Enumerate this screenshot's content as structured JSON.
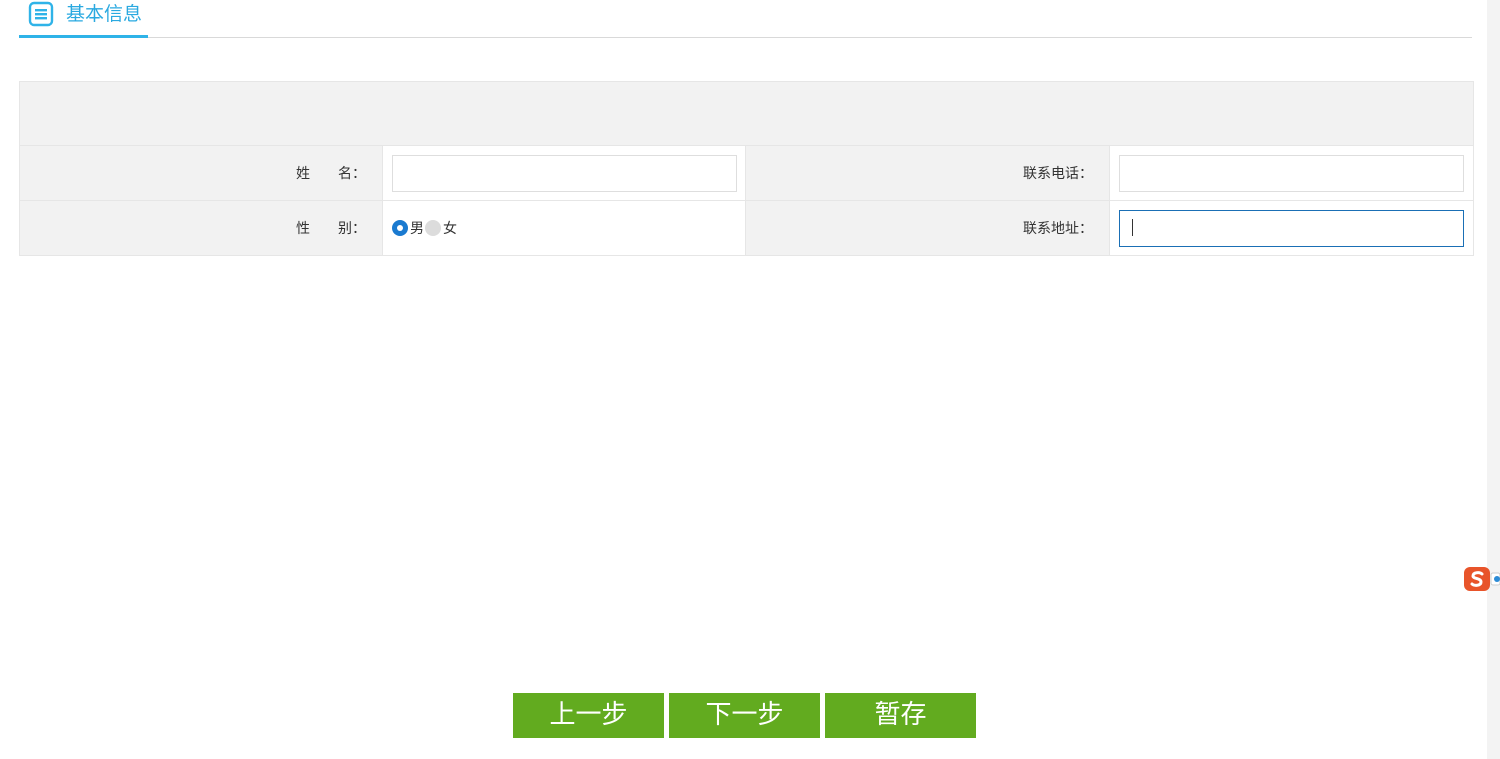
{
  "section": {
    "title": "基本信息",
    "icon": "list-doc-icon",
    "accent_color": "#2fb3e8"
  },
  "form": {
    "name_label_parts": [
      "姓",
      "名："
    ],
    "phone_label": "联系电话：",
    "gender_label_parts": [
      "性",
      "别："
    ],
    "address_label": "联系地址：",
    "name_value": "",
    "phone_value": "",
    "address_value": "",
    "gender_options": [
      {
        "label": "男",
        "checked": true
      },
      {
        "label": "女",
        "checked": false
      }
    ]
  },
  "buttons": {
    "prev_label": "上一步",
    "next_label": "下一步",
    "save_label": "暂存",
    "color": "#62ab1f"
  },
  "ime_widget": {
    "icon": "sogou-ime-icon",
    "color": "#e8542a"
  }
}
